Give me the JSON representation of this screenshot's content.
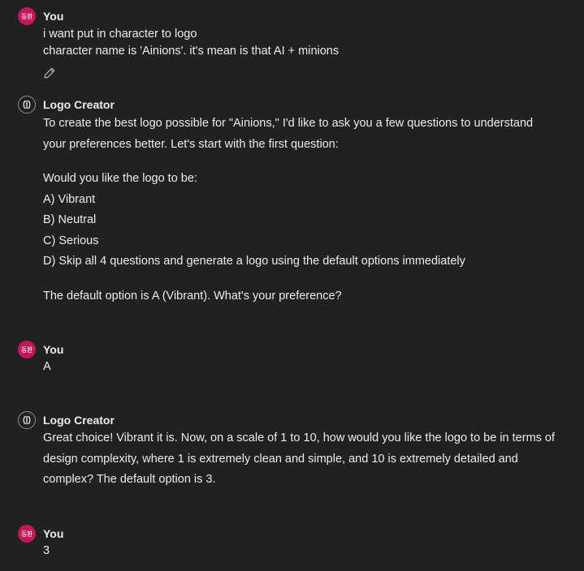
{
  "messages": [
    {
      "role": "user",
      "avatar_text": "동환",
      "author": "You",
      "lines": [
        "i want put in character  to logo",
        "character name is 'Ainions'. it's mean is that AI + minions"
      ]
    },
    {
      "role": "assistant",
      "author": "Logo Creator",
      "lines": [
        "To create the best logo possible for \"Ainions,\" I'd like to ask you a few questions to understand",
        "your preferences better. Let's start with the first question:",
        "",
        "Would you like the logo to be:",
        "A) Vibrant",
        "B) Neutral",
        "C) Serious",
        "D) Skip all 4 questions and generate a logo using the default options immediately",
        "",
        "The default option is A (Vibrant). What's your preference?"
      ]
    },
    {
      "role": "user",
      "avatar_text": "동환",
      "author": "You",
      "lines": [
        "A"
      ]
    },
    {
      "role": "assistant",
      "author": "Logo Creator",
      "lines": [
        "Great choice! Vibrant it is. Now, on a scale of 1 to 10, how would you like the logo to be in terms of",
        "design complexity, where 1 is extremely clean and simple, and 10 is extremely detailed and",
        "complex? The default option is 3."
      ]
    },
    {
      "role": "user",
      "avatar_text": "동환",
      "author": "You",
      "lines": [
        "3"
      ]
    }
  ],
  "icons": {
    "edit": "pencil-icon",
    "assistant_avatar": "logo-creator-icon"
  },
  "colors": {
    "background": "#212121",
    "text": "#ececec",
    "user_avatar": "#c2185b",
    "icon_stroke": "#b4b4b4"
  }
}
